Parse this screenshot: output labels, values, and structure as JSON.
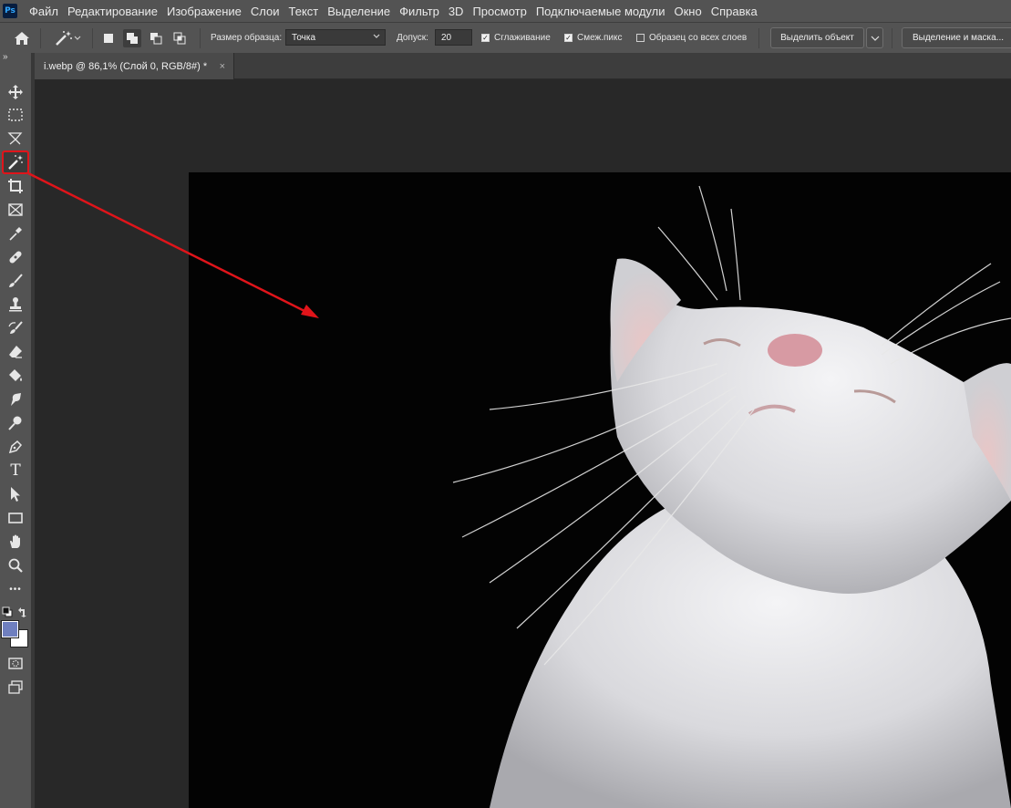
{
  "app": {
    "logo_text": "Ps"
  },
  "menu": [
    "Файл",
    "Редактирование",
    "Изображение",
    "Слои",
    "Текст",
    "Выделение",
    "Фильтр",
    "3D",
    "Просмотр",
    "Подключаемые модули",
    "Окно",
    "Справка"
  ],
  "options_bar": {
    "sample_size_label": "Размер образца:",
    "sample_size_value": "Точка",
    "tolerance_label": "Допуск:",
    "tolerance_value": "20",
    "antialias_label": "Сглаживание",
    "antialias_checked": true,
    "contiguous_label": "Смеж.пикс",
    "contiguous_checked": true,
    "sample_all_layers_label": "Образец со всех слоев",
    "sample_all_layers_checked": false,
    "select_subject_label": "Выделить объект",
    "select_and_mask_label": "Выделение и маска..."
  },
  "document_tab": {
    "title": "i.webp @ 86,1% (Слой 0, RGB/8#) *",
    "close_symbol": "×"
  },
  "toolbar": {
    "collapse_symbol": "»",
    "tools": [
      "move-tool",
      "rectangular-marquee-tool",
      "lasso-tool",
      "magic-wand-tool",
      "crop-tool",
      "frame-tool",
      "eyedropper-tool",
      "healing-brush-tool",
      "brush-tool",
      "clone-stamp-tool",
      "history-brush-tool",
      "eraser-tool",
      "paint-bucket-tool",
      "smudge-tool",
      "dodge-tool",
      "pen-tool",
      "type-tool",
      "path-selection-tool",
      "rectangle-tool",
      "hand-tool",
      "zoom-tool",
      "edit-toolbar"
    ],
    "selected_tool": "magic-wand-tool",
    "type_tool_glyph": "T",
    "more_glyph": "•••",
    "foreground_color": "#6f7fbf",
    "background_color": "#ffffff"
  },
  "annotation": {
    "color": "#e0141a"
  }
}
